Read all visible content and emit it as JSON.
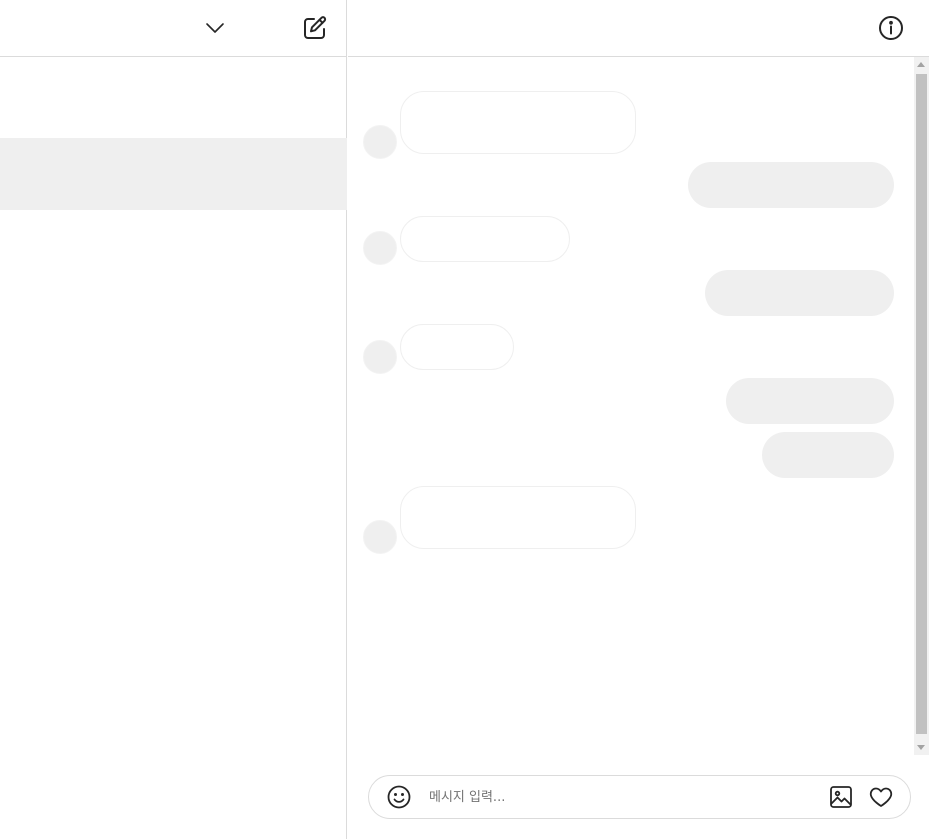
{
  "left_header": {
    "switch_account_icon": "chevron-down-icon",
    "compose_icon": "compose-icon"
  },
  "right_header": {
    "info_icon": "info-icon"
  },
  "conversation": {
    "messages": [
      {
        "direction": "incoming"
      },
      {
        "direction": "outgoing"
      },
      {
        "direction": "incoming"
      },
      {
        "direction": "outgoing"
      },
      {
        "direction": "incoming"
      },
      {
        "direction": "outgoing"
      },
      {
        "direction": "outgoing"
      },
      {
        "direction": "incoming"
      }
    ]
  },
  "composer": {
    "placeholder": "메시지 입력...",
    "value": "",
    "emoji_icon": "emoji-icon",
    "image_icon": "image-icon",
    "like_icon": "heart-icon"
  },
  "colors": {
    "border": "#dbdbdb",
    "skeleton": "#efefef",
    "placeholder_text": "#737373",
    "icon": "#262626"
  }
}
